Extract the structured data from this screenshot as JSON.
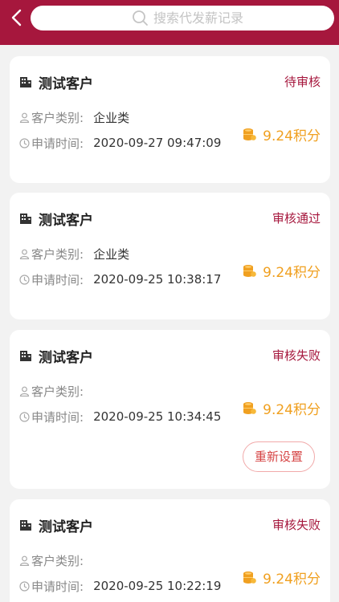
{
  "header": {
    "back_icon": "chevron-left-icon",
    "search_icon": "search-icon",
    "search_placeholder": "搜索代发薪记录",
    "color": "#a6173d"
  },
  "records": [
    {
      "title": "测试客户",
      "status": "待审核",
      "category_label": "客户类别:",
      "category_value": "企业类",
      "time_label": "申请时间:",
      "time_value": "2020-09-27 09:47:09",
      "points": "9.24积分"
    },
    {
      "title": "测试客户",
      "status": "审核通过",
      "category_label": "客户类别:",
      "category_value": "企业类",
      "time_label": "申请时间:",
      "time_value": "2020-09-25 10:38:17",
      "points": "9.24积分"
    },
    {
      "title": "测试客户",
      "status": "审核失败",
      "category_label": "客户类别:",
      "category_value": "",
      "time_label": "申请时间:",
      "time_value": "2020-09-25 10:34:45",
      "points": "9.24积分",
      "action_label": "重新设置"
    },
    {
      "title": "测试客户",
      "status": "审核失败",
      "category_label": "客户类别:",
      "category_value": "",
      "time_label": "申请时间:",
      "time_value": "2020-09-25 10:22:19",
      "points": "9.24积分"
    }
  ],
  "icons": {
    "building": "building-icon",
    "person": "person-icon",
    "clock": "clock-icon",
    "coin": "coin-stack-icon"
  },
  "colors": {
    "brand": "#a6173d",
    "points": "#f0a020",
    "reset_border": "#f1aaaa",
    "reset_text": "#d64545"
  }
}
